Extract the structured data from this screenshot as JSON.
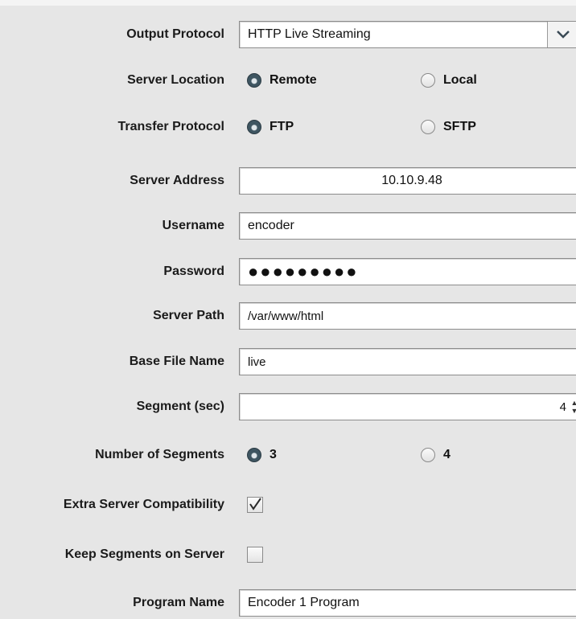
{
  "fields": {
    "output_protocol": {
      "label": "Output Protocol",
      "value": "HTTP Live Streaming",
      "icon": "chevron-down-icon"
    },
    "server_location": {
      "label": "Server Location",
      "options": [
        "Remote",
        "Local"
      ],
      "selected": "Remote"
    },
    "transfer_protocol": {
      "label": "Transfer Protocol",
      "options": [
        "FTP",
        "SFTP"
      ],
      "selected": "FTP"
    },
    "server_address": {
      "label": "Server Address",
      "value": "10.10.9.48"
    },
    "username": {
      "label": "Username",
      "value": "encoder"
    },
    "password": {
      "label": "Password",
      "value": "●●●●●●●●●"
    },
    "server_path": {
      "label": "Server Path",
      "value": "/var/www/html"
    },
    "base_file_name": {
      "label": "Base File Name",
      "value": "live"
    },
    "segment_sec": {
      "label": "Segment (sec)",
      "value": "4"
    },
    "number_of_segments": {
      "label": "Number of Segments",
      "options": [
        "3",
        "4"
      ],
      "selected": "3"
    },
    "extra_server_compat": {
      "label": "Extra Server Compatibility",
      "checked": true
    },
    "keep_segments": {
      "label": "Keep Segments on Server",
      "checked": false
    },
    "program_name": {
      "label": "Program Name",
      "value": "Encoder 1 Program"
    }
  },
  "colors": {
    "background": "#e6e6e6",
    "radio_selected": "#3e5561"
  }
}
